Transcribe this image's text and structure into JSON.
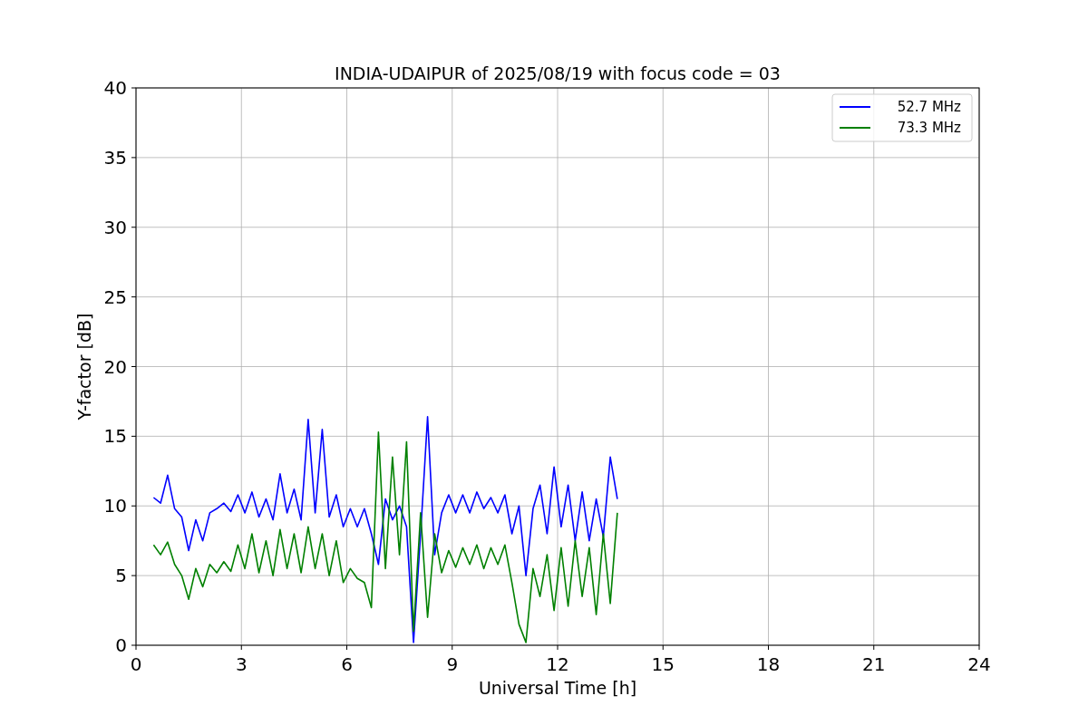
{
  "chart_data": {
    "type": "line",
    "title": "INDIA-UDAIPUR of 2025/08/19 with focus code = 03",
    "xlabel": "Universal Time [h]",
    "ylabel": "Y-factor [dB]",
    "x": [
      0.5,
      0.7,
      0.9,
      1.1,
      1.3,
      1.5,
      1.7,
      1.9,
      2.1,
      2.3,
      2.5,
      2.7,
      2.9,
      3.1,
      3.3,
      3.5,
      3.7,
      3.9,
      4.1,
      4.3,
      4.5,
      4.7,
      4.9,
      5.1,
      5.3,
      5.5,
      5.7,
      5.9,
      6.1,
      6.3,
      6.5,
      6.7,
      6.9,
      7.1,
      7.3,
      7.5,
      7.7,
      7.9,
      8.1,
      8.3,
      8.5,
      8.7,
      8.9,
      9.1,
      9.3,
      9.5,
      9.7,
      9.9,
      10.1,
      10.3,
      10.5,
      10.7,
      10.9,
      11.1,
      11.3,
      11.5,
      11.7,
      11.9,
      12.1,
      12.3,
      12.5,
      12.7,
      12.9,
      13.1,
      13.3,
      13.5,
      13.7
    ],
    "series": [
      {
        "name": "52.7 MHz",
        "color": "#0000ff",
        "values": [
          10.6,
          10.2,
          12.2,
          9.8,
          9.2,
          6.8,
          9.0,
          7.5,
          9.5,
          9.8,
          10.2,
          9.6,
          10.8,
          9.5,
          11.0,
          9.2,
          10.5,
          9.0,
          12.3,
          9.5,
          11.2,
          9.0,
          16.2,
          9.5,
          15.5,
          9.2,
          10.8,
          8.5,
          9.8,
          8.5,
          9.8,
          8.0,
          5.8,
          10.5,
          9.0,
          10.0,
          8.5,
          0.2,
          8.0,
          16.4,
          6.5,
          9.5,
          10.8,
          9.5,
          10.8,
          9.5,
          11.0,
          9.8,
          10.6,
          9.5,
          10.8,
          8.0,
          10.0,
          5.0,
          9.8,
          11.5,
          8.0,
          12.8,
          8.5,
          11.5,
          7.5,
          11.0,
          7.5,
          10.5,
          7.8,
          13.5,
          10.5
        ]
      },
      {
        "name": "73.3 MHz",
        "color": "#008000",
        "values": [
          7.2,
          6.5,
          7.4,
          5.8,
          5.0,
          3.3,
          5.5,
          4.2,
          5.8,
          5.2,
          6.0,
          5.3,
          7.2,
          5.5,
          8.0,
          5.2,
          7.5,
          5.0,
          8.3,
          5.5,
          8.0,
          5.2,
          8.5,
          5.5,
          8.0,
          5.0,
          7.5,
          4.5,
          5.5,
          4.8,
          4.5,
          2.7,
          15.3,
          5.5,
          13.5,
          6.5,
          14.6,
          1.0,
          9.5,
          2.0,
          8.0,
          5.2,
          6.8,
          5.6,
          7.0,
          5.8,
          7.2,
          5.5,
          7.0,
          5.8,
          7.2,
          4.5,
          1.5,
          0.2,
          5.5,
          3.5,
          6.5,
          2.5,
          7.0,
          2.8,
          7.5,
          3.5,
          7.0,
          2.2,
          8.0,
          3.0,
          9.5
        ]
      }
    ],
    "grid": true,
    "legend": true,
    "xlim": [
      0,
      24
    ],
    "ylim": [
      0,
      40
    ],
    "xticks": [
      0,
      3,
      6,
      9,
      12,
      15,
      18,
      21,
      24
    ],
    "yticks": [
      0,
      5,
      10,
      15,
      20,
      25,
      30,
      35,
      40
    ]
  }
}
